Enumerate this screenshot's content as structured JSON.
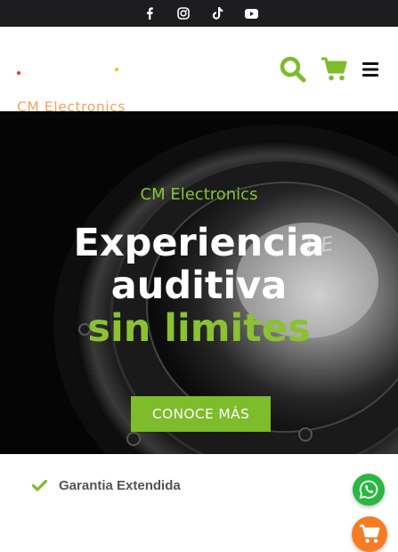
{
  "topbar": {
    "icons": [
      "facebook-icon",
      "instagram-icon",
      "tiktok-icon",
      "youtube-icon"
    ]
  },
  "header": {
    "logo_text": "CM Electronics",
    "icons": [
      "search-icon",
      "cart-icon",
      "menu-icon"
    ]
  },
  "hero": {
    "subtitle": "CM Electronics",
    "title_line1": "Experiencia",
    "title_line2": "auditiva",
    "title_line3": "sin limites",
    "cta_label": "CONOCE MÁS"
  },
  "features": {
    "items": [
      {
        "label": "Garantia Extendida",
        "icon": "check-icon"
      }
    ]
  },
  "floating": {
    "icons": [
      "whatsapp-icon",
      "shopping-cart-icon"
    ]
  },
  "colors": {
    "brand_green": "#7dbc2a",
    "topbar": "#1d1d1f",
    "logo_orange": "#f0a25a",
    "whatsapp": "#2bb741",
    "cart_orange": "#f57c24"
  }
}
